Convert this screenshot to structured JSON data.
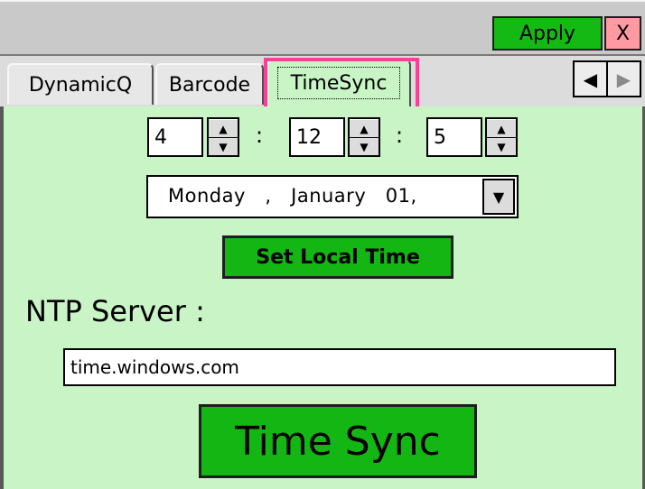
{
  "titlebar": {
    "apply_label": "Apply",
    "close_label": "X"
  },
  "tabs": [
    {
      "label": "DynamicQ",
      "selected": false
    },
    {
      "label": "Barcode",
      "selected": false
    },
    {
      "label": "TimeSync",
      "selected": true
    }
  ],
  "tab_nav": {
    "left_icon": "triangle-left-icon",
    "right_icon": "triangle-right-icon"
  },
  "time": {
    "hour": "4",
    "minute": "12",
    "second": "5",
    "separator": ":",
    "spin_up_icon": "triangle-up-icon",
    "spin_down_icon": "triangle-down-icon"
  },
  "date": {
    "value": "Monday   ,   January   01,",
    "dropdown_icon": "triangle-down-icon"
  },
  "set_local_time_label": "Set Local Time",
  "ntp": {
    "label": "NTP Server :",
    "value": "time.windows.com"
  },
  "time_sync_label": "Time Sync",
  "colors": {
    "panel_bg": "#c8f4c6",
    "button_green": "#13b613",
    "close_pink": "#ff9aa2",
    "highlight": "#ff3f97"
  }
}
